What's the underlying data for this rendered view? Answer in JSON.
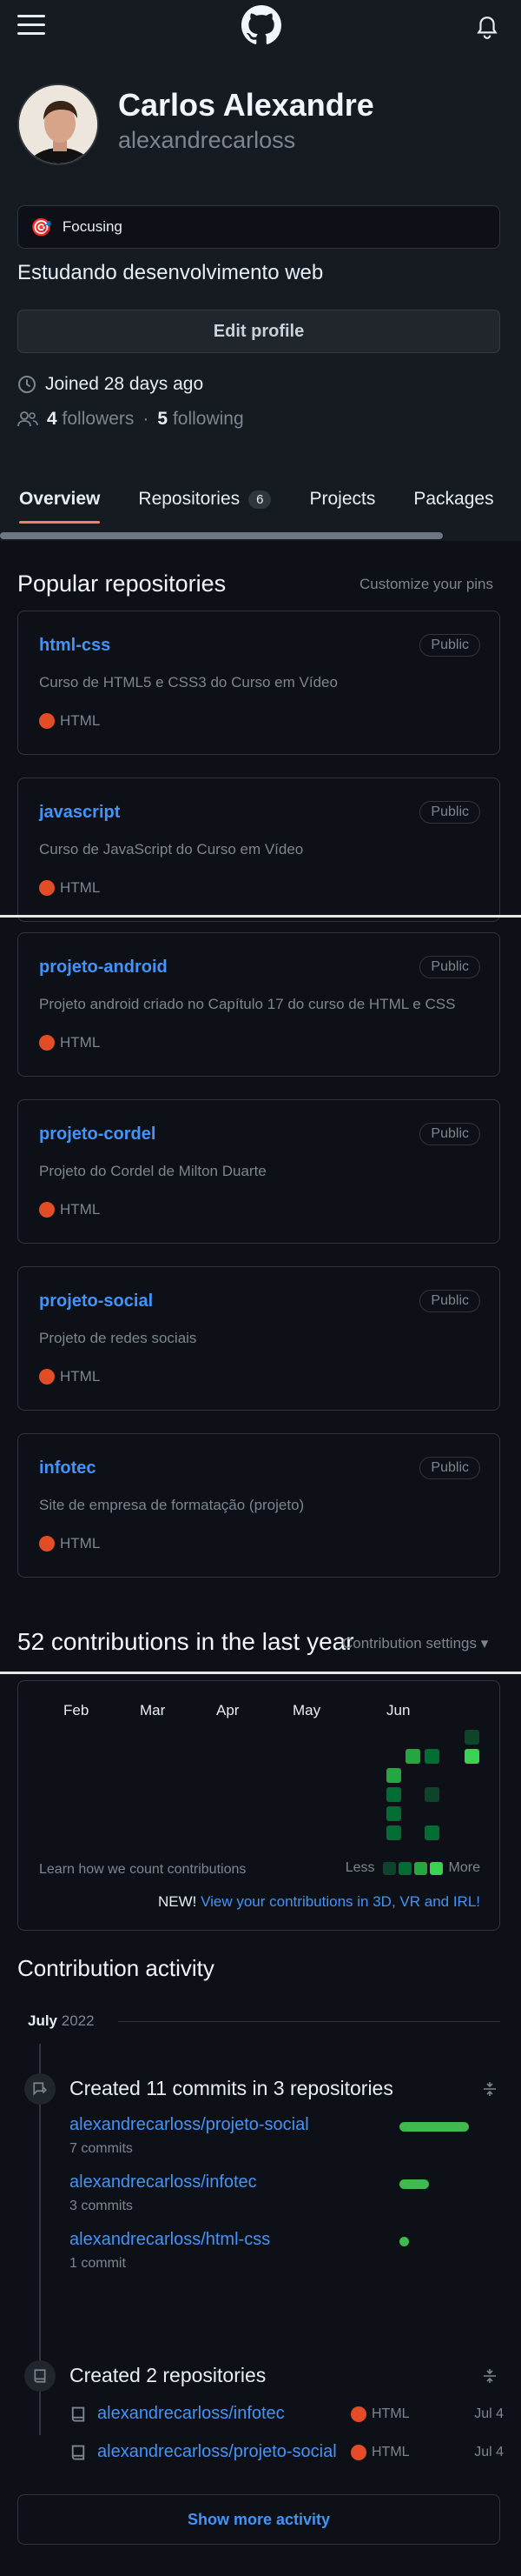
{
  "header": {
    "menu_icon": "hamburger-icon",
    "logo_icon": "github-logo-icon",
    "notif_icon": "bell-icon"
  },
  "profile": {
    "name": "Carlos Alexandre",
    "login": "alexandrecarloss",
    "status": {
      "emoji": "🎯",
      "text": "Focusing"
    },
    "bio": "Estudando desenvolvimento web",
    "edit_label": "Edit profile",
    "joined": "Joined 28 days ago",
    "followers_count": "4",
    "followers_label": "followers",
    "separator": "·",
    "following_count": "5",
    "following_label": "following"
  },
  "tabs": [
    {
      "label": "Overview"
    },
    {
      "label": "Repositories",
      "counter": "6"
    },
    {
      "label": "Projects"
    },
    {
      "label": "Packages"
    }
  ],
  "popular": {
    "title": "Popular repositories",
    "customize": "Customize your pins",
    "repos": [
      {
        "name": "html-css",
        "visibility": "Public",
        "description": "Curso de HTML5 e CSS3 do Curso em Vídeo",
        "language": "HTML"
      },
      {
        "name": "javascript",
        "visibility": "Public",
        "description": "Curso de JavaScript do Curso em Vídeo",
        "language": "HTML"
      },
      {
        "name": "projeto-android",
        "visibility": "Public",
        "description": "Projeto android criado no Capítulo 17 do curso de HTML e CSS",
        "language": "HTML"
      },
      {
        "name": "projeto-cordel",
        "visibility": "Public",
        "description": "Projeto do Cordel de Milton Duarte",
        "language": "HTML"
      },
      {
        "name": "projeto-social",
        "visibility": "Public",
        "description": "Projeto de redes sociais",
        "language": "HTML"
      },
      {
        "name": "infotec",
        "visibility": "Public",
        "description": "Site de empresa de formatação (projeto)",
        "language": "HTML"
      }
    ]
  },
  "contributions": {
    "title": "52 contributions in the last year",
    "settings": "Contribution settings ▾",
    "months": [
      "Feb",
      "Mar",
      "Apr",
      "May",
      "Jun"
    ],
    "learn": "Learn how we count contributions",
    "less": "Less",
    "more": "More",
    "new_prefix": "NEW!",
    "new_link": "View your contributions in 3D, VR and IRL!"
  },
  "activity": {
    "title": "Contribution activity",
    "month": "July",
    "year": "2022",
    "commits": {
      "heading": "Created 11 commits in 3 repositories",
      "items": [
        {
          "repo": "alexandrecarloss/projeto-social",
          "count": "7 commits",
          "share": 7
        },
        {
          "repo": "alexandrecarloss/infotec",
          "count": "3 commits",
          "share": 3
        },
        {
          "repo": "alexandrecarloss/html-css",
          "count": "1 commit",
          "share": 1
        }
      ]
    },
    "repos_created": {
      "heading": "Created 2 repositories",
      "items": [
        {
          "repo": "alexandrecarloss/infotec",
          "language": "HTML",
          "date": "Jul 4"
        },
        {
          "repo": "alexandrecarloss/projeto-social",
          "language": "HTML",
          "date": "Jul 4"
        }
      ]
    },
    "show_more": "Show more activity"
  },
  "colors": {
    "accent": "#4493f8",
    "html_lang": "#e34c26",
    "tab_underline": "#f78166",
    "commit_bar": "#3fb950"
  }
}
